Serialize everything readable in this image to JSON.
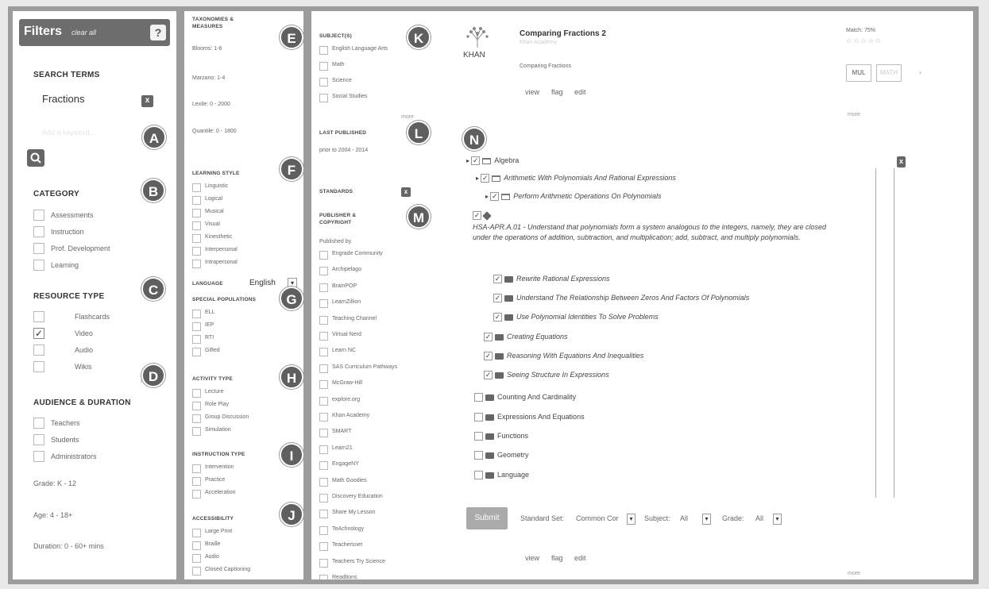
{
  "filters": {
    "title": "Filters",
    "clear_all": "clear all",
    "help": "?",
    "search_terms_heading": "SEARCH TERMS",
    "search_term": "Fractions",
    "remove": "x",
    "add_search_placeholder": "Add a keyword...",
    "category_heading": "CATEGORY",
    "category_items": [
      "Assessments",
      "Instruction",
      "Prof. Development",
      "Learning"
    ],
    "resource_type_heading": "RESOURCE TYPE",
    "resource_items": [
      "Flashcards",
      "Video",
      "Audio",
      "Wikis"
    ],
    "resource_checked": "Video",
    "more": "more",
    "audience_heading": "AUDIENCE & DURATION",
    "audience_items": [
      "Teachers",
      "Students",
      "Administrators"
    ],
    "grade": "Grade: K - 12",
    "age": "Age: 4 - 18+",
    "duration": "Duration: 0 - 60+ mins"
  },
  "col2": {
    "taxonomies_heading": "TAXONOMIES & MEASURES",
    "blooms": "Blooms: 1-6",
    "marzano": "Marzano: 1-4",
    "lexile": "Lexile: 0 - 2000",
    "quantile": "Quantile: 0 - 1800",
    "learning_style_heading": "LEARNING STYLE",
    "learning_styles": [
      "Linguistic",
      "Logical",
      "Musical",
      "Visual",
      "Kinesthetic",
      "Interpersonal",
      "Intrapersonal"
    ],
    "language_label": "LANGUAGE",
    "language_value": "English",
    "special_pop_heading": "SPECIAL POPULATIONS",
    "special_pops": [
      "ELL",
      "IEP",
      "RTI",
      "Gifted"
    ],
    "activity_heading": "ACTIVITY TYPE",
    "activities": [
      "Lecture",
      "Role Play",
      "Group Discussion",
      "Simulation"
    ],
    "instruction_heading": "INSTRUCTION TYPE",
    "instructions": [
      "Intervention",
      "Practice",
      "Acceleration"
    ],
    "accessibility_heading": "ACCESSIBILITY",
    "accessibility": [
      "Large Print",
      "Braille",
      "Audio",
      "Closed Captioning"
    ]
  },
  "col3": {
    "subjects_heading": "SUBJECT(S)",
    "subjects": [
      "English Language Arts",
      "Math",
      "Science",
      "Social Studies"
    ],
    "more": "more",
    "last_published_heading": "LAST PUBLISHED",
    "last_published_value": "prior to 2004 - 2014",
    "standards_heading": "STANDARDS",
    "standards_x": "x",
    "publisher_heading": "PUBLISHER & COPYRIGHT",
    "published_by": "Published by",
    "publishers": [
      "Engrade Community",
      "Archipelago",
      "BrainPOP",
      "LearnZillion",
      "Teaching Channel",
      "Virtual Nerd",
      "Learn NC",
      "SAS Curriculum Pathways",
      "McGraw-Hill",
      "explore.org",
      "Khan Academy",
      "SMART",
      "Learn21",
      "EngageNY",
      "Math Goodies",
      "Discovery Education",
      "Share My Lesson",
      "TeAchnology",
      "Teachersnet",
      "Teachers Try Science",
      "Readtions"
    ]
  },
  "result": {
    "logo_text": "KHAN",
    "title": "Comparing Fractions 2",
    "source": "Khan Academy",
    "description": "Comparing Fractions",
    "actions": [
      "view",
      "flag",
      "edit"
    ],
    "match": "Match: 75%",
    "chips": [
      "MUL",
      "MATH"
    ],
    "more": "more"
  },
  "markers": [
    "A",
    "B",
    "C",
    "D",
    "E",
    "F",
    "G",
    "H",
    "I",
    "J",
    "K",
    "L",
    "M",
    "N"
  ],
  "tree": {
    "close": "x",
    "rows": [
      {
        "label": "Algebra",
        "checked": true,
        "italic": false
      },
      {
        "label": "Arithmetic With Polynomials And Rational Expressions",
        "checked": true,
        "italic": true
      },
      {
        "label": "Perform Arithmetic Operations On Polynomials",
        "checked": true,
        "italic": true
      },
      {
        "label": "HSA-APR.A.01 - Understand that polynomials form a system analogous to the integers, namely, they are closed under the operations of addition, subtraction, and multiplication; add, subtract, and multiply polynomials.",
        "checked": true,
        "italic": true
      },
      {
        "label": "Rewrite Rational Expressions",
        "checked": true,
        "italic": true
      },
      {
        "label": "Understand The Relationship Between Zeros And Factors Of Polynomials",
        "checked": true,
        "italic": true
      },
      {
        "label": "Use Polynomial Identities To Solve Problems",
        "checked": true,
        "italic": true
      },
      {
        "label": "Creating Equations",
        "checked": true,
        "italic": true
      },
      {
        "label": "Reasoning With Equations And Inequalities",
        "checked": true,
        "italic": true
      },
      {
        "label": "Seeing Structure In Expressions",
        "checked": true,
        "italic": true
      },
      {
        "label": "Counting And Cardinality",
        "checked": false,
        "italic": false
      },
      {
        "label": "Expressions And Equations",
        "checked": false,
        "italic": false
      },
      {
        "label": "Functions",
        "checked": false,
        "italic": false
      },
      {
        "label": "Geometry",
        "checked": false,
        "italic": false
      },
      {
        "label": "Language",
        "checked": false,
        "italic": false
      }
    ]
  },
  "standard_bar": {
    "submit": "Submit",
    "standard_set_label": "Standard Set:",
    "standard_set_value": "Common Cor",
    "subject_label": "Subject:",
    "subject_value": "All",
    "grade_label": "Grade:",
    "grade_value": "All"
  },
  "bottom_actions": [
    "view",
    "flag",
    "edit"
  ],
  "bottom_more": "more"
}
